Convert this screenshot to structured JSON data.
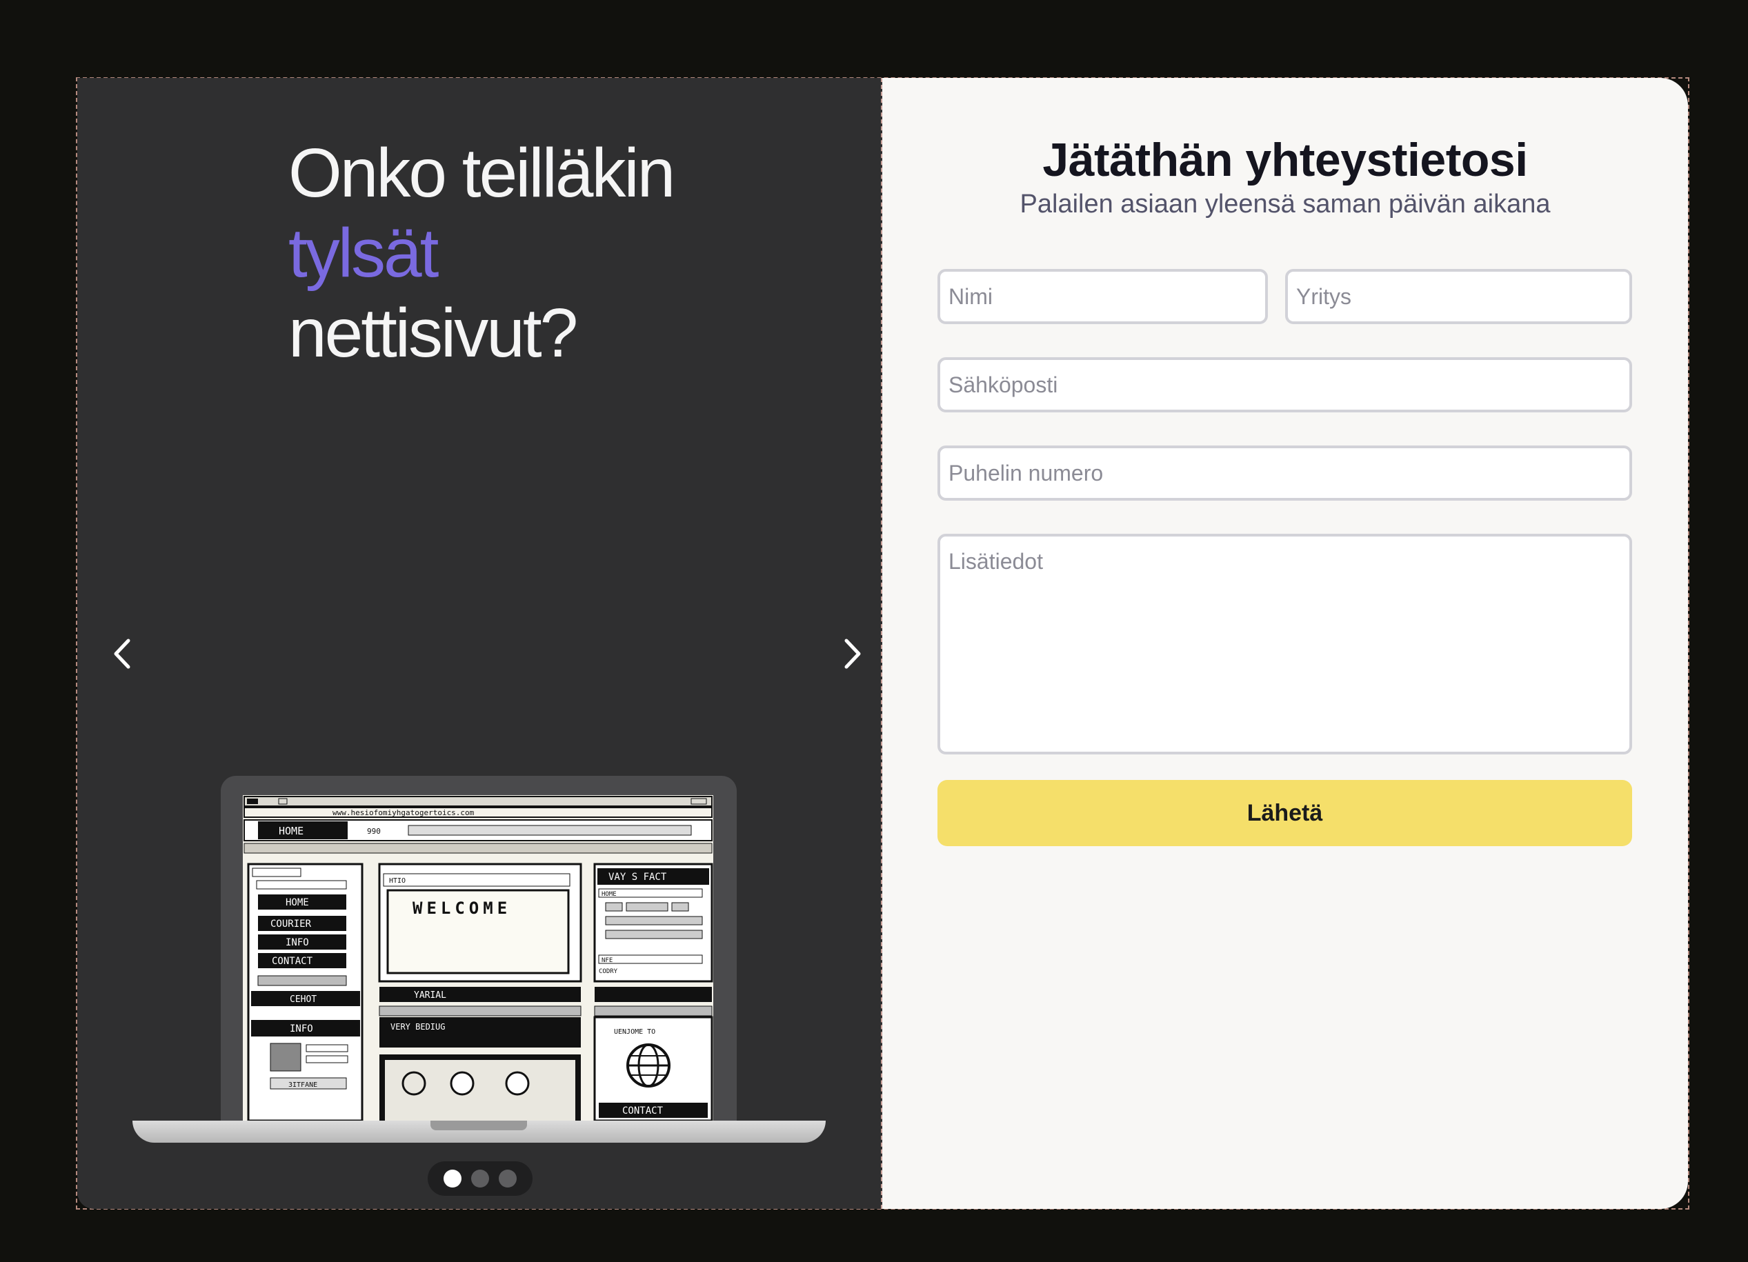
{
  "slide": {
    "headline_line1": "Onko teilläkin",
    "headline_accent": "tylsät",
    "headline_line3": "nettisivut?",
    "accent_color": "#7a6ae0",
    "prev_icon": "chevron-left-icon",
    "next_icon": "chevron-right-icon",
    "dots": [
      {
        "active": true
      },
      {
        "active": false
      },
      {
        "active": false
      }
    ],
    "illustration": {
      "url": "www.hesiofomiyhgatogertoics.com",
      "top_home": "HOME",
      "top_field": "990",
      "left_menu": [
        "HOME",
        "COURIER",
        "INFO",
        "CONTACT"
      ],
      "left_caption": "CEHOT",
      "left_box_title": "INFO",
      "left_box_btn": "3ITFANE",
      "center_tab": "HTIO",
      "center_welcome": "WELCOME",
      "center_bar1": "YARIAL",
      "center_bar2": "VERY BEDIUG",
      "right_title": "VAY S FACT",
      "right_small1": "HOME",
      "right_small2": "NFE",
      "right_small3": "CODRY",
      "right_welcome": "UENJOME TO",
      "right_contact": "CONTACT"
    }
  },
  "form": {
    "title": "Jätäthän yhteystietosi",
    "subtitle": "Palailen asiaan yleensä saman päivän aikana",
    "name_placeholder": "Nimi",
    "company_placeholder": "Yritys",
    "email_placeholder": "Sähköposti",
    "phone_placeholder": "Puhelin numero",
    "details_placeholder": "Lisätiedot",
    "submit_label": "Lähetä",
    "submit_color": "#f5df6a"
  }
}
